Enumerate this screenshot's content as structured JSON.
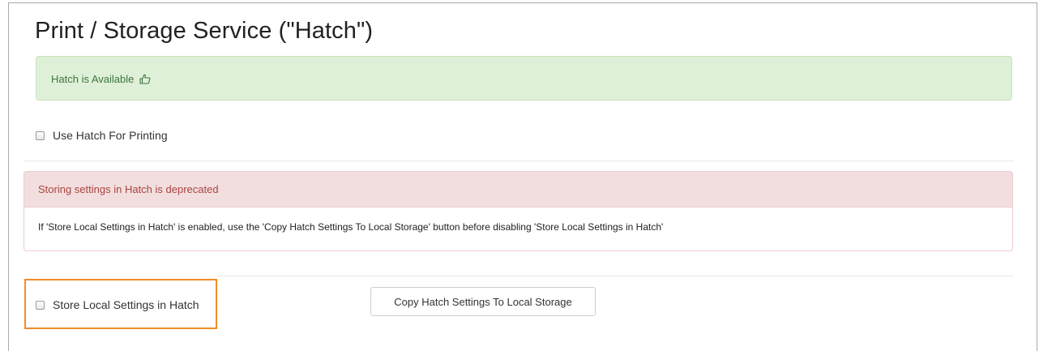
{
  "page": {
    "title": "Print / Storage Service (\"Hatch\")"
  },
  "status_alert": {
    "message": "Hatch is Available",
    "icon": "thumbs-up-icon",
    "color": "#3c763d"
  },
  "printing_option": {
    "label": "Use Hatch For Printing",
    "checked": false
  },
  "deprecation_panel": {
    "heading": "Storing settings in Hatch is deprecated",
    "body": "If 'Store Local Settings in Hatch' is enabled, use the 'Copy Hatch Settings To Local Storage' button before disabling 'Store Local Settings in Hatch'",
    "heading_color": "#a94442"
  },
  "storage_option": {
    "label": "Store Local Settings in Hatch",
    "checked": false,
    "highlight_color": "#f28c28"
  },
  "copy_button": {
    "label": "Copy Hatch Settings To Local Storage"
  }
}
